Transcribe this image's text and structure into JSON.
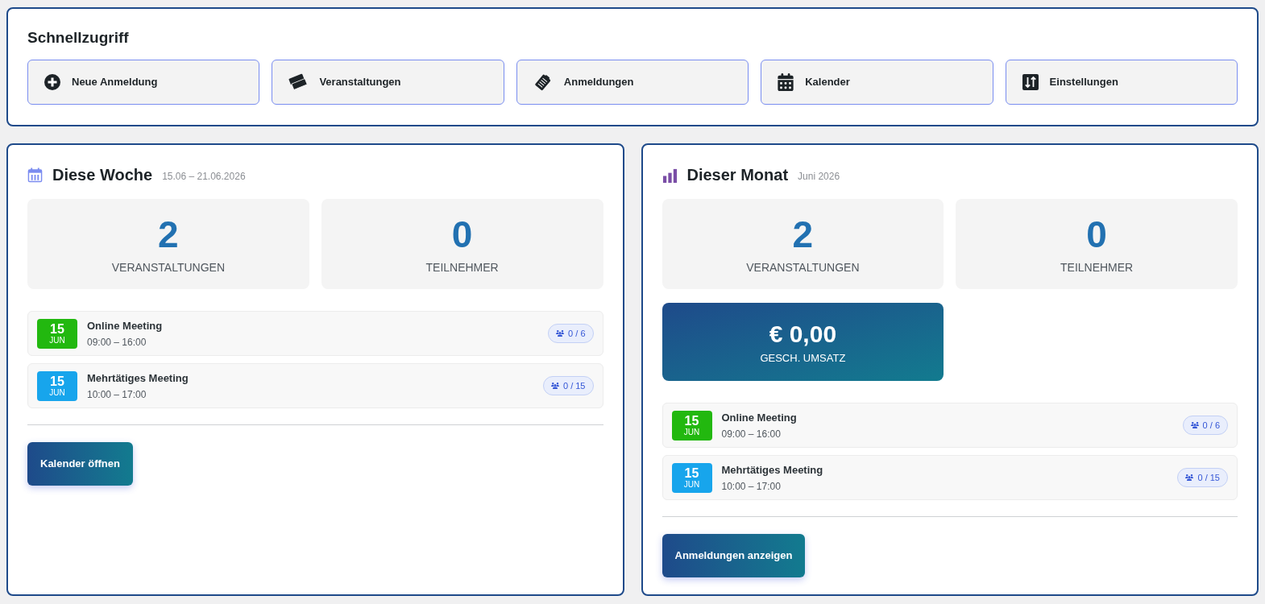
{
  "quick_access": {
    "title": "Schnellzugriff",
    "buttons": [
      {
        "label": "Neue Anmeldung"
      },
      {
        "label": "Veranstaltungen"
      },
      {
        "label": "Anmeldungen"
      },
      {
        "label": "Kalender"
      },
      {
        "label": "Einstellungen"
      }
    ]
  },
  "panels": [
    {
      "title": "Diese Woche",
      "subtitle": "15.06 – 21.06.2026",
      "stats": [
        {
          "value": "2",
          "label": "VERANSTALTUNGEN"
        },
        {
          "value": "0",
          "label": "TEILNEHMER"
        }
      ],
      "events": [
        {
          "day": "15",
          "month": "JUN",
          "color": "#22b80f",
          "title": "Online Meeting",
          "time": "09:00 – 16:00",
          "capacity": "0 / 6"
        },
        {
          "day": "15",
          "month": "JUN",
          "color": "#17a5ec",
          "title": "Mehrtätiges Meeting",
          "time": "10:00 – 17:00",
          "capacity": "0 / 15"
        }
      ],
      "button": "Kalender öffnen"
    },
    {
      "title": "Dieser Monat",
      "subtitle": "Juni 2026",
      "stats": [
        {
          "value": "2",
          "label": "VERANSTALTUNGEN"
        },
        {
          "value": "0",
          "label": "TEILNEHMER"
        }
      ],
      "revenue": {
        "value": "€ 0,00",
        "label": "GESCH. UMSATZ"
      },
      "events": [
        {
          "day": "15",
          "month": "JUN",
          "color": "#22b80f",
          "title": "Online Meeting",
          "time": "09:00 – 16:00",
          "capacity": "0 / 6"
        },
        {
          "day": "15",
          "month": "JUN",
          "color": "#17a5ec",
          "title": "Mehrtätiges Meeting",
          "time": "10:00 – 17:00",
          "capacity": "0 / 15"
        }
      ],
      "button": "Anmeldungen anzeigen"
    }
  ]
}
